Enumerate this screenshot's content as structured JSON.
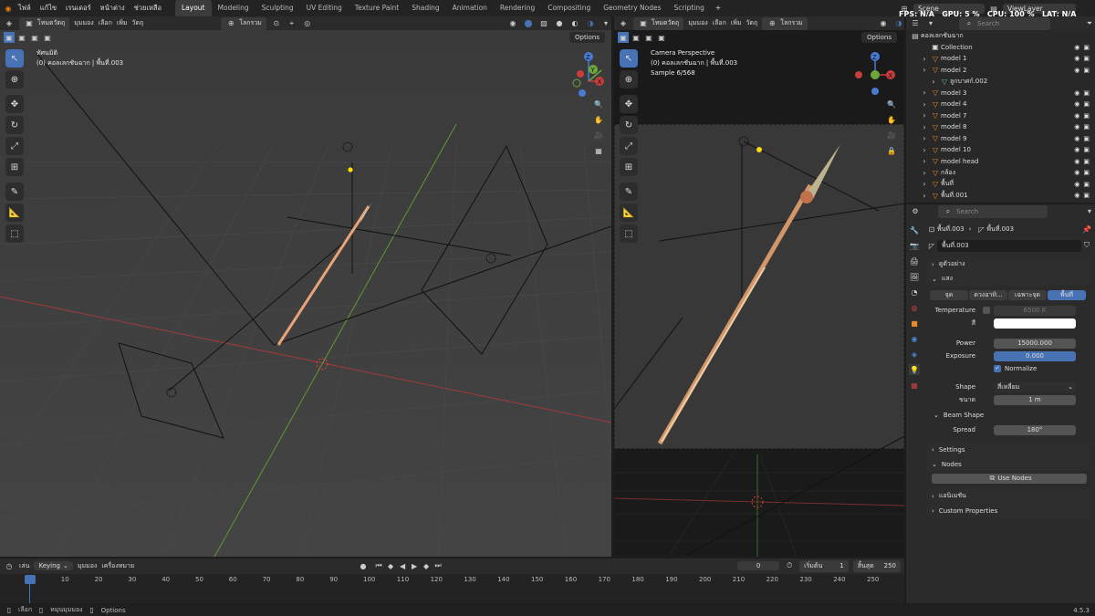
{
  "menu": {
    "items": [
      "ไฟล์",
      "แก้ไข",
      "เรนเดอร์",
      "หน้าต่าง",
      "ช่วยเหลือ"
    ]
  },
  "workspaces": [
    "Layout",
    "Modeling",
    "Sculpting",
    "UV Editing",
    "Texture Paint",
    "Shading",
    "Animation",
    "Rendering",
    "Compositing",
    "Geometry Nodes",
    "Scripting"
  ],
  "top_right": {
    "scene": "Scene",
    "viewlayer": "ViewLayer",
    "stats": "FPS: N/A   GPU: 5 %   CPU: 100 %   LAT: N/A"
  },
  "left_view": {
    "mode": "โหมดวัตถุ",
    "menus": [
      "มุมมอง",
      "เลือก",
      "เพิ่ม",
      "วัตถุ"
    ],
    "orientation": "โลกรวม",
    "options": "Options",
    "title": "ทัศนมิติ",
    "subtitle": "(0) คอลเลกชันฉาก | พื้นที่.003"
  },
  "right_view": {
    "mode": "โหมดวัตถุ",
    "menus": [
      "มุมมอง",
      "เลือก",
      "เพิ่ม",
      "วัตถุ"
    ],
    "orientation": "โลกรวม",
    "options": "Options",
    "title": "Camera Perspective",
    "subtitle": "(0) คอลเลกชันฉาก | พื้นที่.003",
    "sample": "Sample 6/568"
  },
  "outliner": {
    "search": "Search",
    "root": "คอลเลกชันฉาก",
    "items": [
      {
        "label": "Collection",
        "indent": 1
      },
      {
        "label": "model 1",
        "indent": 1
      },
      {
        "label": "model 2",
        "indent": 1
      },
      {
        "label": "ลูกบาศก์.002",
        "indent": 2
      },
      {
        "label": "model 3",
        "indent": 1
      },
      {
        "label": "model 4",
        "indent": 1
      },
      {
        "label": "model 7",
        "indent": 1
      },
      {
        "label": "model 8",
        "indent": 1
      },
      {
        "label": "model 9",
        "indent": 1
      },
      {
        "label": "model 10",
        "indent": 1
      },
      {
        "label": "model head",
        "indent": 1
      },
      {
        "label": "กล้อง",
        "indent": 1
      },
      {
        "label": "พื้นที่",
        "indent": 1
      },
      {
        "label": "พื้นที่.001",
        "indent": 1
      }
    ]
  },
  "properties": {
    "search": "Search",
    "breadcrumb_a": "พื้นที่.003",
    "breadcrumb_b": "พื้นที่.003",
    "datablock": "พื้นที่.003",
    "sec_preview": "ดูตัวอย่าง",
    "sec_light": "แสง",
    "light_types": [
      "จุด",
      "ดวงอาทิ...",
      "เฉพาะจุด",
      "พื้นที่"
    ],
    "temperature_label": "Temperature",
    "temperature_value": "6500 K",
    "color_label": "สี",
    "power_label": "Power",
    "power_value": "15000.000",
    "exposure_label": "Exposure",
    "exposure_value": "0.000",
    "normalize_label": "Normalize",
    "shape_label": "Shape",
    "shape_value": "สี่เหลี่ยม",
    "size_label": "ขนาด",
    "size_value": "1 m",
    "beam_label": "Beam Shape",
    "spread_label": "Spread",
    "spread_value": "180°",
    "settings": "Settings",
    "nodes": "Nodes",
    "use_nodes": "Use Nodes",
    "animation": "แอนิเมชัน",
    "custom": "Custom Properties"
  },
  "timeline": {
    "play": "เล่น",
    "keying": "Keying",
    "view": "มุมมอง",
    "marker": "เครื่องหมาย",
    "current": "0",
    "start_label": "เริ่มต้น",
    "start": "1",
    "end_label": "สิ้นสุด",
    "end": "250",
    "ticks": [
      "0",
      "10",
      "20",
      "30",
      "40",
      "50",
      "60",
      "70",
      "80",
      "90",
      "100",
      "110",
      "120",
      "130",
      "140",
      "150",
      "160",
      "170",
      "180",
      "190",
      "200",
      "210",
      "220",
      "230",
      "240",
      "250"
    ]
  },
  "status": {
    "select": "เลือก",
    "rotate": "หมุนมุมมอง",
    "options": "Options",
    "version": "4.5.3"
  },
  "colors": {
    "accent": "#4772b3",
    "red_axis": "#c83c3c",
    "green_axis": "#6aa83a"
  }
}
